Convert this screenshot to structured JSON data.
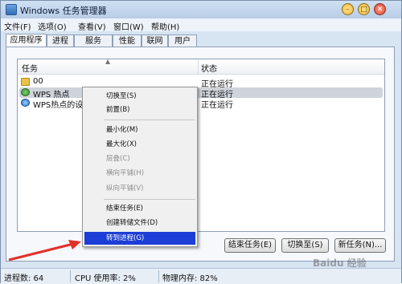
{
  "window": {
    "title": "Windows 任务管理器"
  },
  "menubar": {
    "items": [
      "文件(F)",
      "选项(O)",
      "查看(V)",
      "窗口(W)",
      "帮助(H)"
    ]
  },
  "tabs": [
    "应用程序",
    "进程",
    "服务",
    "性能",
    "联网",
    "用户"
  ],
  "list": {
    "columns": {
      "task": "任务",
      "status": "状态"
    },
    "rows": [
      {
        "task": "00",
        "status": "正在运行",
        "icon": "folder-icon"
      },
      {
        "task": "WPS 热点",
        "status": "正在运行",
        "icon": "wps-icon"
      },
      {
        "task": "WPS热点的设置",
        "status": "正在运行",
        "icon": "ie-icon"
      }
    ]
  },
  "context_menu": {
    "items": [
      "切换至(S)",
      "前置(B)",
      "最小化(M)",
      "最大化(X)",
      "层叠(C)",
      "横向平铺(H)",
      "纵向平铺(V)",
      "结束任务(E)",
      "创建转储文件(D)",
      "转到进程(G)"
    ]
  },
  "buttons": {
    "end_task": "结束任务(E)",
    "switch_to": "切换至(S)",
    "new_task": "新任务(N)..."
  },
  "statusbar": {
    "processes": "进程数: 64",
    "cpu": "CPU 使用率: 2%",
    "memory": "物理内存: 82%"
  },
  "watermark": "Baidu 经验",
  "colors": {
    "highlight": "#1c3dd6",
    "arrow": "#e0302a",
    "titlebar": "#b8cde6"
  }
}
